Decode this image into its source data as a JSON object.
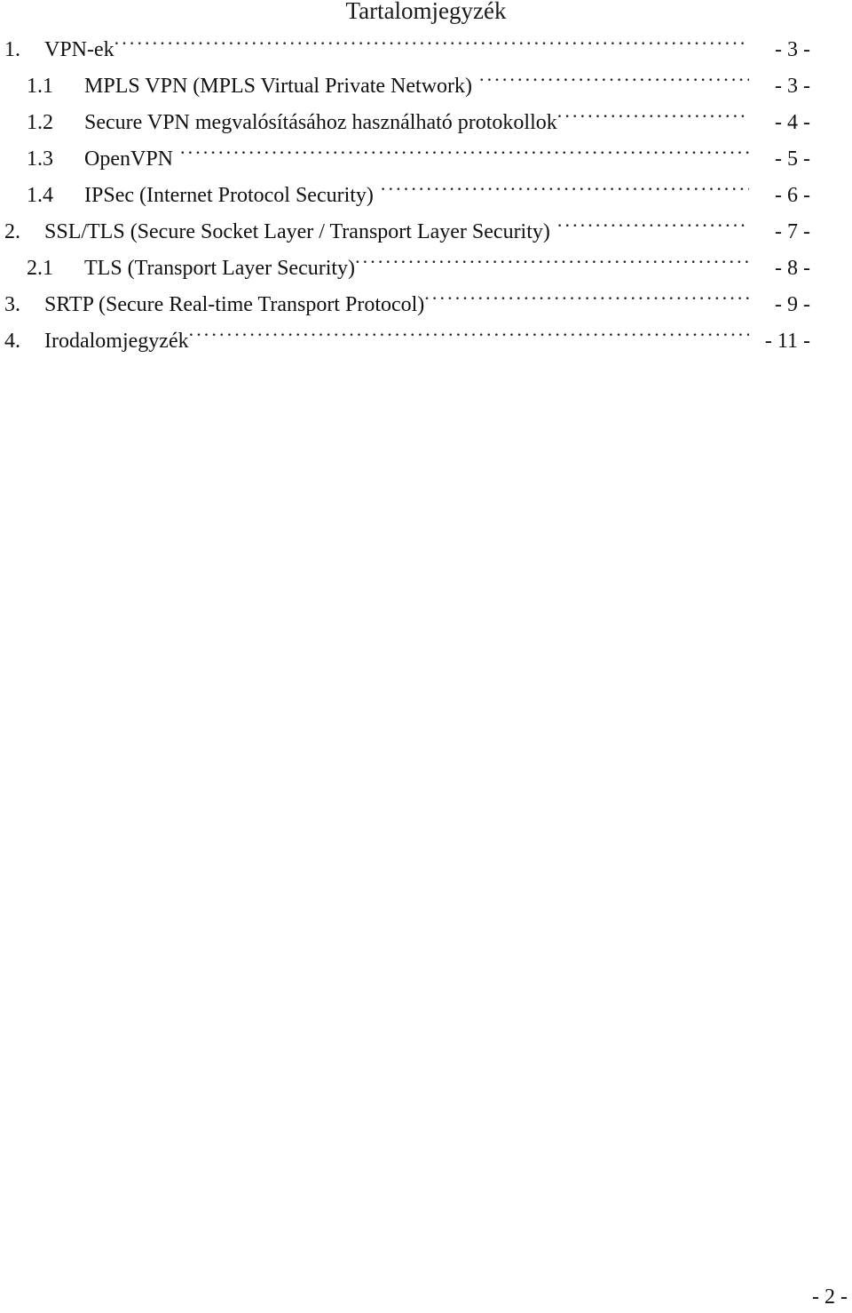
{
  "document": {
    "title": "Tartalomjegyzék",
    "footer_page_label": "- 2 -"
  },
  "toc": {
    "entries": [
      {
        "number": "1.",
        "level": 1,
        "text": "VPN-ek",
        "page": "- 3 -",
        "space_before_leader": false
      },
      {
        "number": "1.1",
        "level": 2,
        "text": "MPLS VPN (MPLS Virtual Private Network)",
        "page": "- 3 -",
        "space_before_leader": true
      },
      {
        "number": "1.2",
        "level": 2,
        "text": "Secure VPN megvalósításához használható protokollok",
        "page": "- 4 -",
        "space_before_leader": false
      },
      {
        "number": "1.3",
        "level": 2,
        "text": "OpenVPN",
        "page": "- 5 -",
        "space_before_leader": true
      },
      {
        "number": "1.4",
        "level": 2,
        "text": "IPSec (Internet Protocol Security)",
        "page": "- 6 -",
        "space_before_leader": true
      },
      {
        "number": "2.",
        "level": 1,
        "text": "SSL/TLS (Secure Socket Layer / Transport Layer Security)",
        "page": "- 7 -",
        "space_before_leader": true
      },
      {
        "number": "2.1",
        "level": 2,
        "text": "TLS (Transport Layer Security)",
        "page": "- 8 -",
        "space_before_leader": false
      },
      {
        "number": "3.",
        "level": 1,
        "text": "SRTP (Secure Real-time Transport Protocol)",
        "page": "- 9 -",
        "space_before_leader": false
      },
      {
        "number": "4.",
        "level": 1,
        "text": "Irodalomjegyzék",
        "page": "- 11 -",
        "space_before_leader": false
      }
    ]
  }
}
